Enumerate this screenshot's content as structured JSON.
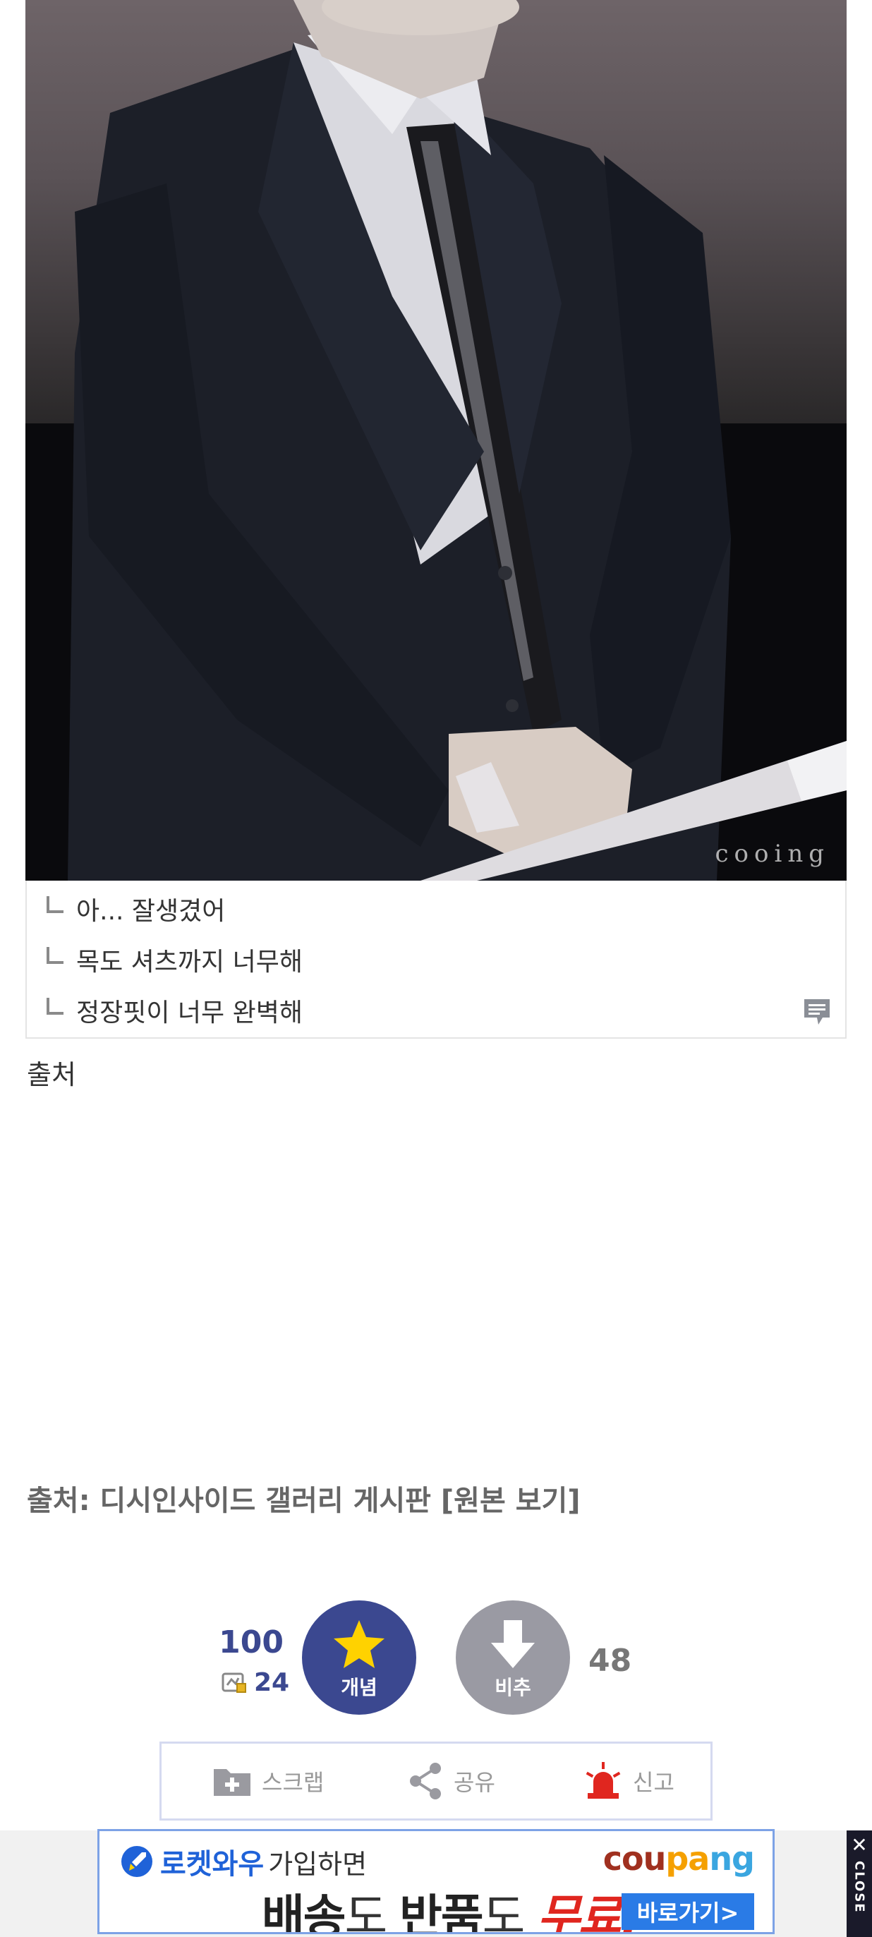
{
  "photo": {
    "alt": "",
    "watermark": "cooing"
  },
  "comment_preview": {
    "lines": [
      "아... 잘생겼어",
      "목도 셔츠까지 너무해",
      "정장핏이 너무 완벽해"
    ]
  },
  "post": {
    "short_text": "출처",
    "source": "출처: 디시인사이드 갤러리 게시판 [원본 보기]"
  },
  "votes": {
    "up_count": "100",
    "fixed_reply_count": "24",
    "up_label": "개념",
    "down_label": "비추",
    "down_count": "48"
  },
  "actions": {
    "scrap_label": "스크랩",
    "share_label": "공유",
    "report_label": "신고"
  },
  "ad": {
    "rocket_text": "로켓와우",
    "join_text": "가입하면",
    "brand": [
      "cou",
      "pa",
      "ng"
    ],
    "main_1": "배송",
    "main_2": "도 ",
    "main_3": "반품",
    "main_4": "도 ",
    "main_5": "무료!",
    "cta": "바로가기>",
    "close_mark": "✕",
    "close_word": "CLOSE"
  },
  "colors": {
    "accent": "#3b4890",
    "downvote": "#9a9aa3",
    "report": "#e0261f",
    "ad_border": "#7da2e6"
  }
}
